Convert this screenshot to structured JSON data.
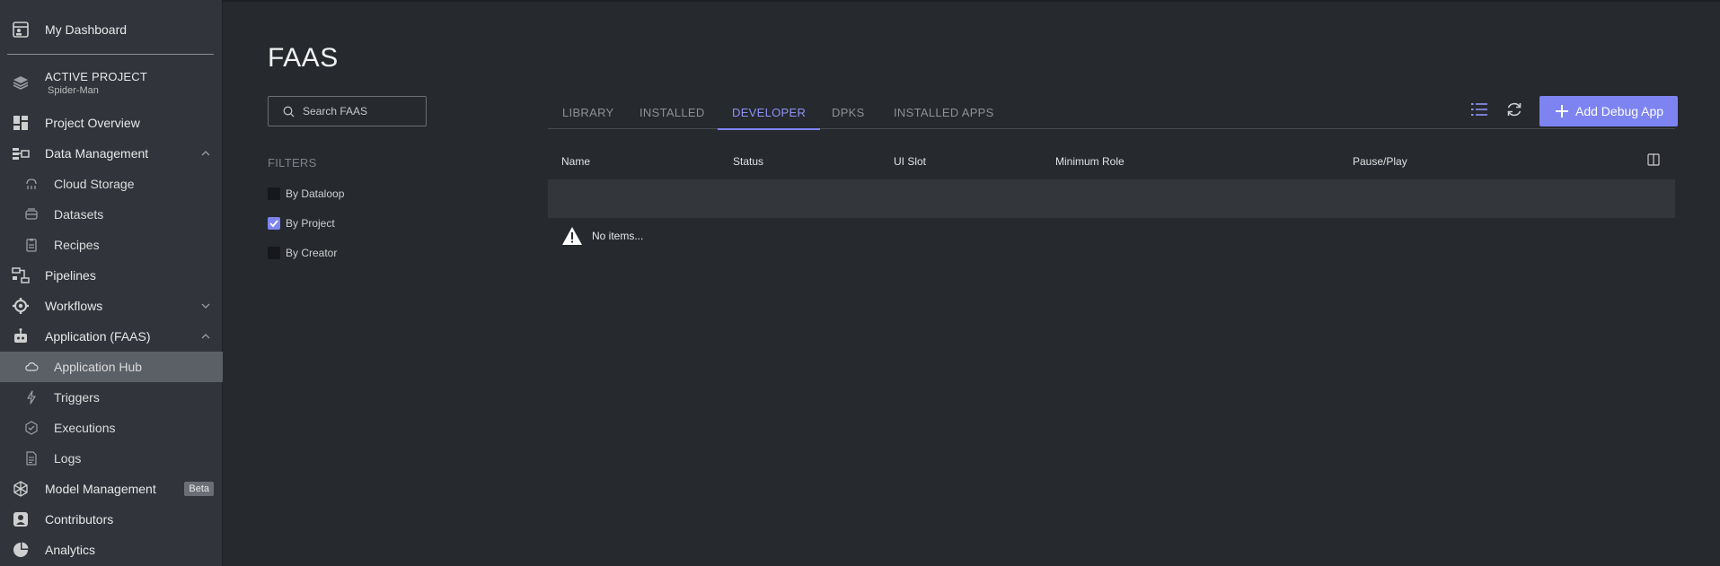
{
  "sidebar": {
    "dashboard": "My Dashboard",
    "active_project_label": "ACTIVE PROJECT",
    "active_project_name": "Spider-Man",
    "items": [
      {
        "label": "Project Overview",
        "icon": "grid-icon"
      },
      {
        "label": "Data Management",
        "icon": "data-icon",
        "expanded": true
      },
      {
        "label": "Cloud Storage",
        "icon": "cloud-storage-icon"
      },
      {
        "label": "Datasets",
        "icon": "datasets-icon"
      },
      {
        "label": "Recipes",
        "icon": "recipes-icon"
      },
      {
        "label": "Pipelines",
        "icon": "pipelines-icon"
      },
      {
        "label": "Workflows",
        "icon": "workflows-icon",
        "expanded": false
      },
      {
        "label": "Application (FAAS)",
        "icon": "application-icon",
        "expanded": true
      },
      {
        "label": "Application Hub",
        "icon": "cloud-icon",
        "active": true
      },
      {
        "label": "Triggers",
        "icon": "bolt-icon"
      },
      {
        "label": "Executions",
        "icon": "executions-icon"
      },
      {
        "label": "Logs",
        "icon": "logs-icon"
      },
      {
        "label": "Model Management",
        "icon": "model-icon",
        "badge": "Beta"
      },
      {
        "label": "Contributors",
        "icon": "contributors-icon"
      },
      {
        "label": "Analytics",
        "icon": "pie-chart-icon"
      }
    ]
  },
  "main": {
    "title": "FAAS",
    "search_placeholder": "Search FAAS",
    "filters_heading": "FILTERS",
    "filters": [
      {
        "label": "By Dataloop",
        "checked": false
      },
      {
        "label": "By Project",
        "checked": true
      },
      {
        "label": "By Creator",
        "checked": false
      }
    ],
    "tabs": [
      "LIBRARY",
      "INSTALLED",
      "DEVELOPER",
      "DPKS",
      "INSTALLED APPS"
    ],
    "active_tab": "DEVELOPER",
    "add_button": "Add Debug App",
    "columns": [
      "Name",
      "Status",
      "UI Slot",
      "Minimum Role",
      "Pause/Play"
    ],
    "empty_message": "No items..."
  },
  "colors": {
    "accent": "#7d84f2",
    "sidebar_bg": "#31353b",
    "main_bg": "#26292e",
    "active_item": "#5b5f66"
  }
}
